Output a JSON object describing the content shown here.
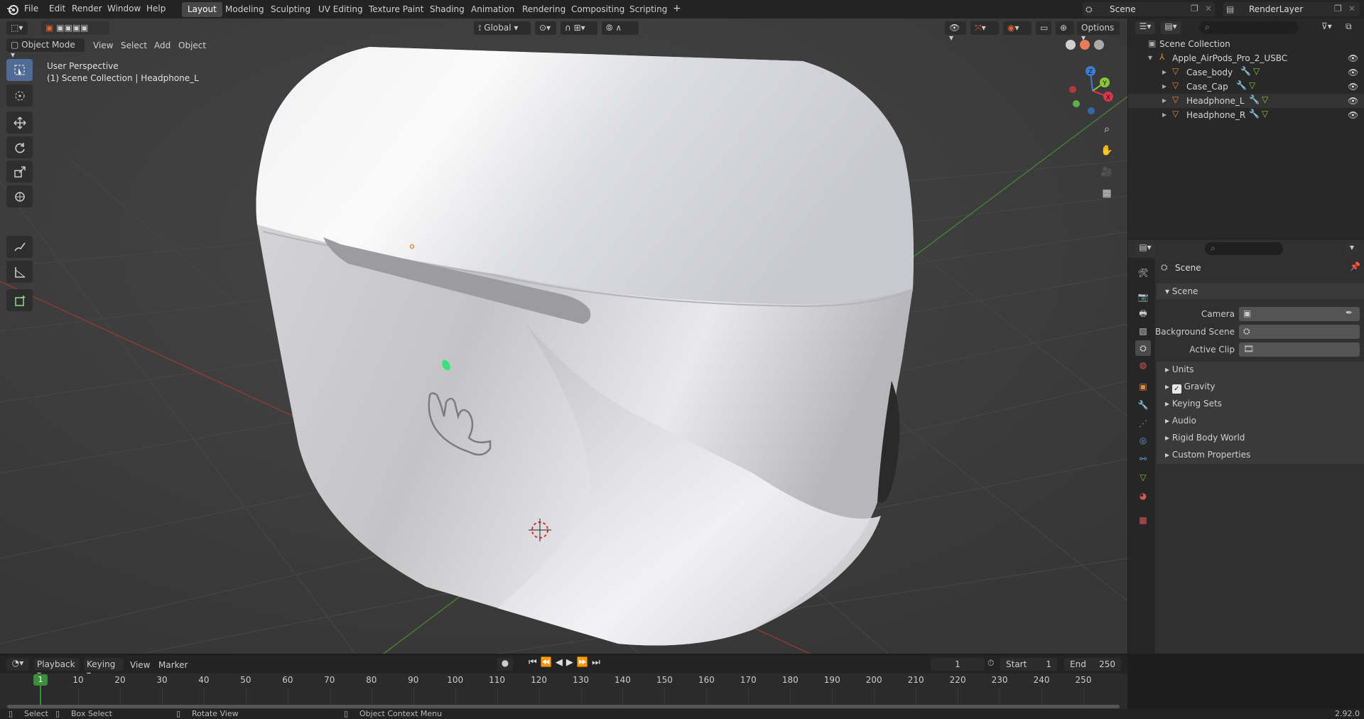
{
  "menu": [
    "File",
    "Edit",
    "Render",
    "Window",
    "Help"
  ],
  "workspaces": [
    "Layout",
    "Modeling",
    "Sculpting",
    "UV Editing",
    "Texture Paint",
    "Shading",
    "Animation",
    "Rendering",
    "Compositing",
    "Scripting"
  ],
  "active_workspace": "Layout",
  "scene_field": "Scene",
  "renderlayer_field": "RenderLayer",
  "viewport": {
    "mode": "Object Mode",
    "menus": [
      "View",
      "Select",
      "Add",
      "Object"
    ],
    "transform_orientation": "Global",
    "options_label": "Options",
    "overlay_title": "User Perspective",
    "overlay_subtitle": "(1) Scene Collection | Headphone_L",
    "gizmo_axes": {
      "x": "X",
      "y": "Y",
      "z": "Z"
    }
  },
  "outliner": {
    "root": "Scene Collection",
    "collection": "Apple_AirPods_Pro_2_USBC",
    "objects": [
      "Case_body",
      "Case_Cap",
      "Headphone_L",
      "Headphone_R"
    ]
  },
  "properties": {
    "header": "Scene",
    "panel": "Scene",
    "fields": [
      {
        "label": "Camera"
      },
      {
        "label": "Background Scene"
      },
      {
        "label": "Active Clip"
      }
    ],
    "sections": [
      "Units",
      "Gravity",
      "Keying Sets",
      "Audio",
      "Rigid Body World",
      "Custom Properties"
    ],
    "gravity_checked": true
  },
  "timeline": {
    "menus": [
      "Playback",
      "Keying",
      "View",
      "Marker"
    ],
    "current_frame": "1",
    "start_label": "Start",
    "start": "1",
    "end_label": "End",
    "end": "250",
    "ticks": [
      "1",
      "10",
      "20",
      "30",
      "40",
      "50",
      "60",
      "70",
      "80",
      "90",
      "100",
      "110",
      "120",
      "130",
      "140",
      "150",
      "160",
      "170",
      "180",
      "190",
      "200",
      "210",
      "220",
      "230",
      "240",
      "250"
    ]
  },
  "status": {
    "select": "Select",
    "box_select": "Box Select",
    "rotate_view": "Rotate View",
    "context_menu": "Object Context Menu",
    "version": "2.92.0"
  },
  "colors": {
    "accent": "#4f6b96",
    "x_axis": "#d7384a",
    "y_axis": "#8ac437",
    "z_axis": "#3d7dd6",
    "mesh_icon": "#e08a3a"
  }
}
